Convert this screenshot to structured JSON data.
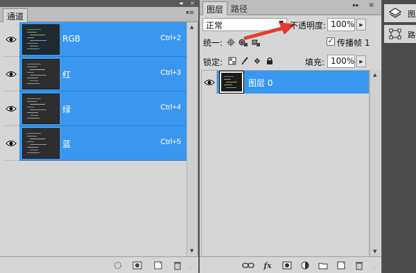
{
  "channels_panel": {
    "tab_label": "通道",
    "collapse_glyph": "◂◂",
    "menu_glyph": "▾≡",
    "channels": [
      {
        "name": "RGB",
        "shortcut": "Ctrl+2"
      },
      {
        "name": "红",
        "shortcut": "Ctrl+3"
      },
      {
        "name": "绿",
        "shortcut": "Ctrl+4"
      },
      {
        "name": "蓝",
        "shortcut": "Ctrl+5"
      }
    ],
    "bottom_icons": [
      "load-selection-icon",
      "save-selection-icon",
      "new-channel-icon",
      "trash-icon"
    ]
  },
  "layers_panel": {
    "tabs": [
      {
        "label": "图层",
        "active": true
      },
      {
        "label": "路径",
        "active": false
      }
    ],
    "collapse_glyph": "▸▸",
    "menu_glyph": "≡",
    "blend_mode": "正常",
    "opacity_label": "不透明度:",
    "opacity_value": "100%",
    "unify_label": "统一:",
    "propagate_label": "传播帧 1",
    "propagate_checked": true,
    "lock_label": "锁定:",
    "fill_label": "填充:",
    "fill_value": "100%",
    "layers": [
      {
        "name": "图层 0",
        "selected": true
      }
    ],
    "bottom_icons": [
      "link-icon",
      "fx-icon",
      "mask-icon",
      "adjustment-icon",
      "folder-icon",
      "new-layer-icon",
      "trash-icon"
    ],
    "fx_label": "fx"
  },
  "dock": {
    "items": [
      {
        "label": "图层",
        "icon": "layers-icon"
      },
      {
        "label": "路径",
        "icon": "paths-icon"
      }
    ]
  },
  "annotation": {
    "arrow_color": "#e53b2f"
  },
  "colors": {
    "selection_blue": "#3a97ef",
    "panel_bg": "#d6d6d6"
  }
}
